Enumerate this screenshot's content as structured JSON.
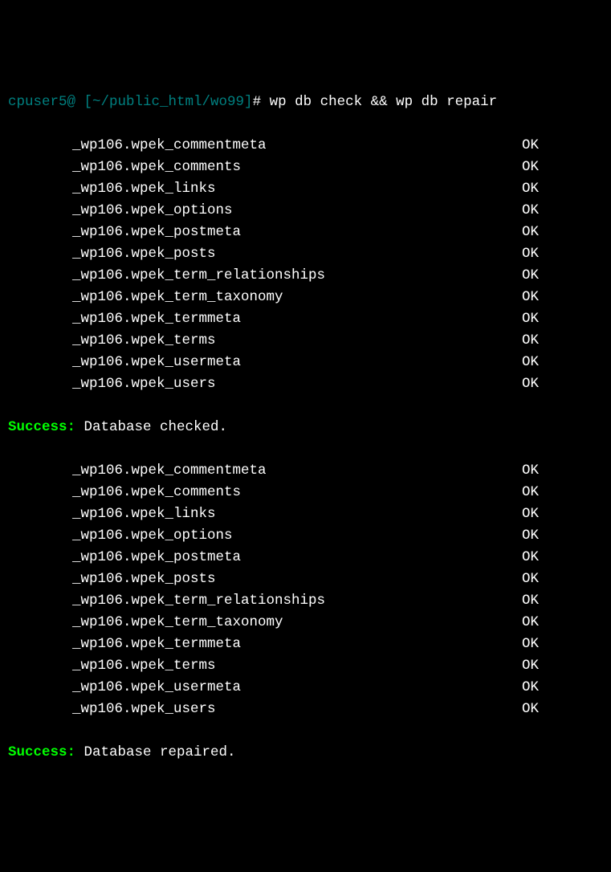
{
  "prompt": {
    "userhost": "cpuser5@",
    "path": " [~/public_html/wo99]",
    "hash": "# ",
    "command": "wp db check && wp db repair"
  },
  "check": {
    "rows": [
      {
        "table": "_wp106.wpek_commentmeta",
        "status": "OK"
      },
      {
        "table": "_wp106.wpek_comments",
        "status": "OK"
      },
      {
        "table": "_wp106.wpek_links",
        "status": "OK"
      },
      {
        "table": "_wp106.wpek_options",
        "status": "OK"
      },
      {
        "table": "_wp106.wpek_postmeta",
        "status": "OK"
      },
      {
        "table": "_wp106.wpek_posts",
        "status": "OK"
      },
      {
        "table": "_wp106.wpek_term_relationships",
        "status": "OK"
      },
      {
        "table": "_wp106.wpek_term_taxonomy",
        "status": "OK"
      },
      {
        "table": "_wp106.wpek_termmeta",
        "status": "OK"
      },
      {
        "table": "_wp106.wpek_terms",
        "status": "OK"
      },
      {
        "table": "_wp106.wpek_usermeta",
        "status": "OK"
      },
      {
        "table": "_wp106.wpek_users",
        "status": "OK"
      }
    ],
    "success_label": "Success:",
    "success_msg": " Database checked."
  },
  "repair": {
    "rows": [
      {
        "table": "_wp106.wpek_commentmeta",
        "status": "OK"
      },
      {
        "table": "_wp106.wpek_comments",
        "status": "OK"
      },
      {
        "table": "_wp106.wpek_links",
        "status": "OK"
      },
      {
        "table": "_wp106.wpek_options",
        "status": "OK"
      },
      {
        "table": "_wp106.wpek_postmeta",
        "status": "OK"
      },
      {
        "table": "_wp106.wpek_posts",
        "status": "OK"
      },
      {
        "table": "_wp106.wpek_term_relationships",
        "status": "OK"
      },
      {
        "table": "_wp106.wpek_term_taxonomy",
        "status": "OK"
      },
      {
        "table": "_wp106.wpek_termmeta",
        "status": "OK"
      },
      {
        "table": "_wp106.wpek_terms",
        "status": "OK"
      },
      {
        "table": "_wp106.wpek_usermeta",
        "status": "OK"
      },
      {
        "table": "_wp106.wpek_users",
        "status": "OK"
      }
    ],
    "success_label": "Success:",
    "success_msg": " Database repaired."
  }
}
